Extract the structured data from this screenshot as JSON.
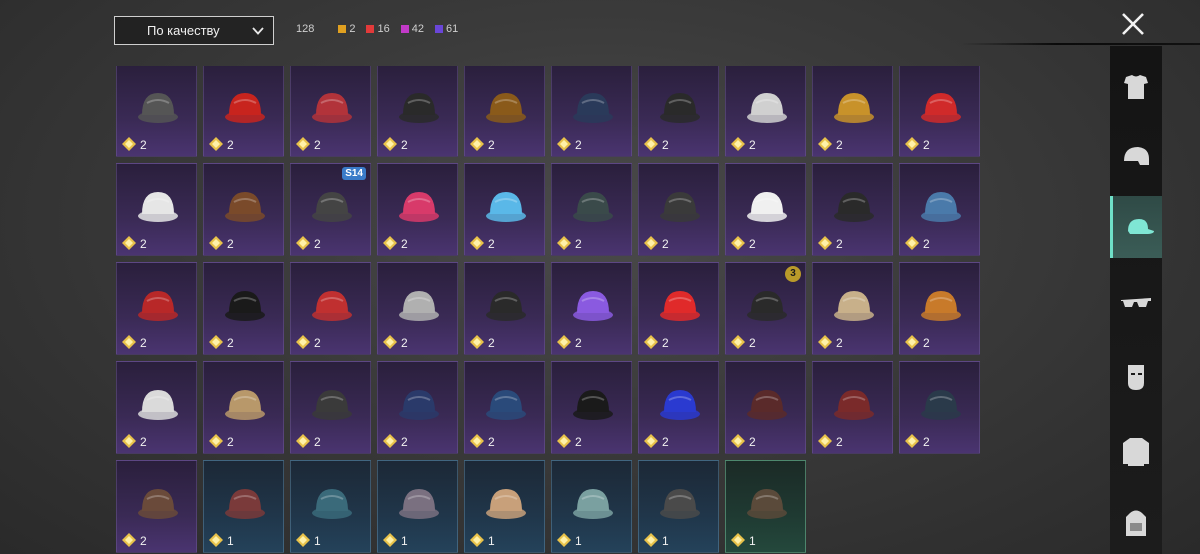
{
  "filter": {
    "sort_label": "По качеству",
    "total": "128",
    "quality_counts": [
      {
        "value": "2",
        "color": "#e0a020"
      },
      {
        "value": "16",
        "color": "#e23a3a"
      },
      {
        "value": "42",
        "color": "#c23ac8"
      },
      {
        "value": "61",
        "color": "#6a46d8"
      }
    ]
  },
  "sidebar": {
    "items": [
      {
        "icon": "outfit-icon",
        "active": false
      },
      {
        "icon": "helmet-icon",
        "active": false
      },
      {
        "icon": "cap-icon",
        "active": true
      },
      {
        "icon": "glasses-icon",
        "active": false
      },
      {
        "icon": "mask-icon",
        "active": false
      },
      {
        "icon": "jacket-icon",
        "active": false
      },
      {
        "icon": "backpack-icon",
        "active": false
      }
    ]
  },
  "items": [
    {
      "name": "witch-hat",
      "qty": "2",
      "rarity": "purple",
      "color": "#555"
    },
    {
      "name": "red-mohawk",
      "qty": "2",
      "rarity": "purple",
      "color": "#c8241e"
    },
    {
      "name": "red-helmet",
      "qty": "2",
      "rarity": "purple",
      "color": "#b2333a"
    },
    {
      "name": "halo-crown",
      "qty": "2",
      "rarity": "purple",
      "color": "#2a2a2a"
    },
    {
      "name": "tribal-mask",
      "qty": "2",
      "rarity": "purple",
      "color": "#8a5a1a"
    },
    {
      "name": "blue-cap",
      "qty": "2",
      "rarity": "purple",
      "color": "#2a3a5a"
    },
    {
      "name": "gas-mask",
      "qty": "2",
      "rarity": "purple",
      "color": "#2a2a2a"
    },
    {
      "name": "goggle-helmet",
      "qty": "2",
      "rarity": "purple",
      "color": "#d0d0d0"
    },
    {
      "name": "beanie-mustard",
      "qty": "2",
      "rarity": "purple",
      "color": "#c8922a"
    },
    {
      "name": "bandana-flag",
      "qty": "2",
      "rarity": "purple",
      "color": "#d02a2a"
    },
    {
      "name": "white-turban",
      "qty": "2",
      "rarity": "purple",
      "color": "#e6e6e6"
    },
    {
      "name": "samurai-mask",
      "qty": "2",
      "rarity": "purple",
      "color": "#7a4a2a"
    },
    {
      "name": "knight-helmet",
      "qty": "2",
      "rarity": "purple",
      "color": "#444",
      "badge": "S14"
    },
    {
      "name": "pink-cap",
      "qty": "2",
      "rarity": "purple",
      "color": "#d83a6a"
    },
    {
      "name": "bunny-ears",
      "qty": "2",
      "rarity": "purple",
      "color": "#5ab8e8"
    },
    {
      "name": "scarf-mask",
      "qty": "2",
      "rarity": "purple",
      "color": "#3a4a4a"
    },
    {
      "name": "black-helmet",
      "qty": "2",
      "rarity": "purple",
      "color": "#3a3a3a"
    },
    {
      "name": "white-visor",
      "qty": "2",
      "rarity": "purple",
      "color": "#f0f0f0"
    },
    {
      "name": "black-beanie",
      "qty": "2",
      "rarity": "purple",
      "color": "#2a2a2a"
    },
    {
      "name": "shark-head",
      "qty": "2",
      "rarity": "purple",
      "color": "#4a7aaa"
    },
    {
      "name": "red-beret",
      "qty": "2",
      "rarity": "purple",
      "color": "#b82828"
    },
    {
      "name": "black-top-hat",
      "qty": "2",
      "rarity": "purple",
      "color": "#1a1a1a"
    },
    {
      "name": "red-fedora",
      "qty": "2",
      "rarity": "purple",
      "color": "#c03030"
    },
    {
      "name": "shark-mask",
      "qty": "2",
      "rarity": "purple",
      "color": "#b0b0b0"
    },
    {
      "name": "headphone-helmet",
      "qty": "2",
      "rarity": "purple",
      "color": "#2a2a2a"
    },
    {
      "name": "flower-crown",
      "qty": "2",
      "rarity": "purple",
      "color": "#8a5ae0"
    },
    {
      "name": "red-bucket-hat",
      "qty": "2",
      "rarity": "purple",
      "color": "#e02a2a"
    },
    {
      "name": "fedora-season",
      "qty": "2",
      "rarity": "purple",
      "color": "#2a2a2a",
      "badge": "3"
    },
    {
      "name": "knit-cap",
      "qty": "2",
      "rarity": "purple",
      "color": "#c8b08a"
    },
    {
      "name": "burger-hat",
      "qty": "2",
      "rarity": "purple",
      "color": "#c87a2a"
    },
    {
      "name": "doctor-mirror",
      "qty": "2",
      "rarity": "purple",
      "color": "#dadada"
    },
    {
      "name": "cardboard-box",
      "qty": "2",
      "rarity": "purple",
      "color": "#b8986a"
    },
    {
      "name": "headband",
      "qty": "2",
      "rarity": "purple",
      "color": "#3a3a3a"
    },
    {
      "name": "pilot-cap",
      "qty": "2",
      "rarity": "purple",
      "color": "#2a3a6a"
    },
    {
      "name": "blue-garrison-cap",
      "qty": "2",
      "rarity": "purple",
      "color": "#2a4a7a"
    },
    {
      "name": "black-gold-cap",
      "qty": "2",
      "rarity": "purple",
      "color": "#1a1a1a"
    },
    {
      "name": "royal-blue-cap",
      "qty": "2",
      "rarity": "purple",
      "color": "#2a3ad0"
    },
    {
      "name": "brown-fedora",
      "qty": "2",
      "rarity": "purple",
      "color": "#5a2a2a"
    },
    {
      "name": "officer-cap",
      "qty": "2",
      "rarity": "purple",
      "color": "#7a2a2a"
    },
    {
      "name": "dark-bucket-hat",
      "qty": "2",
      "rarity": "purple",
      "color": "#2a3a4a"
    },
    {
      "name": "aviator-cap",
      "qty": "2",
      "rarity": "purple",
      "color": "#6a4a3a"
    },
    {
      "name": "leather-cap",
      "qty": "1",
      "rarity": "blue",
      "color": "#7a3a3a"
    },
    {
      "name": "teal-beret",
      "qty": "1",
      "rarity": "blue",
      "color": "#3a6a7a"
    },
    {
      "name": "grey-beret",
      "qty": "1",
      "rarity": "blue",
      "color": "#7a7080"
    },
    {
      "name": "trucker-cap-red",
      "qty": "1",
      "rarity": "blue",
      "color": "#c8a07a"
    },
    {
      "name": "trucker-cap-blue",
      "qty": "1",
      "rarity": "blue",
      "color": "#7aa0a0"
    },
    {
      "name": "camo-cap",
      "qty": "1",
      "rarity": "blue",
      "color": "#4a4a4a"
    },
    {
      "name": "patrol-cap",
      "qty": "1",
      "rarity": "green",
      "color": "#5a4a3a"
    }
  ]
}
